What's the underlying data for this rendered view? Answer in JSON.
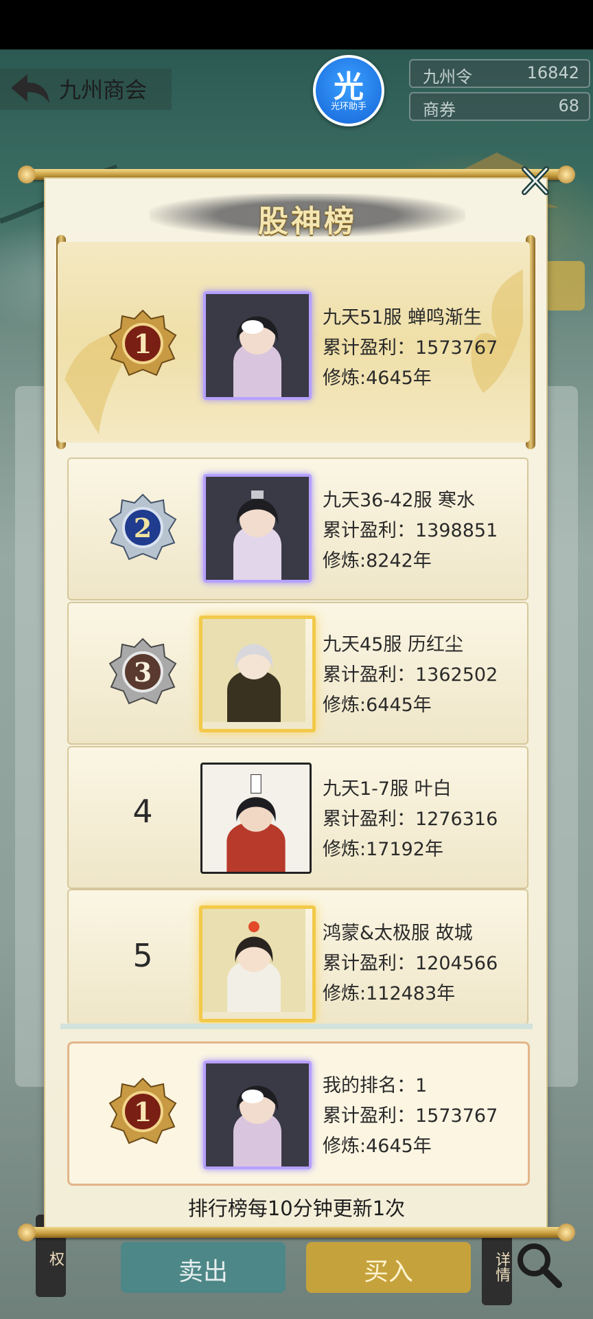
{
  "header": {
    "title": "九州商会",
    "helper_glyph": "光",
    "helper_label": "光环助手",
    "currencies": [
      {
        "name": "九州令",
        "value": "16842"
      },
      {
        "name": "商券",
        "value": "68"
      }
    ]
  },
  "modal": {
    "title": "股神榜",
    "rankings": [
      {
        "rank": "1",
        "badge": "gold-medal",
        "server_name": "九天51服 蝉鸣渐生",
        "profit": "累计盈利：1573767",
        "cultivation": "修炼:4645年"
      },
      {
        "rank": "2",
        "badge": "blue-medal",
        "server_name": "九天36-42服 寒水",
        "profit": "累计盈利：1398851",
        "cultivation": "修炼:8242年"
      },
      {
        "rank": "3",
        "badge": "silver-medal",
        "server_name": "九天45服 历红尘",
        "profit": "累计盈利：1362502",
        "cultivation": "修炼:6445年"
      },
      {
        "rank": "4",
        "badge": "none",
        "server_name": "九天1-7服 叶白",
        "profit": "累计盈利：1276316",
        "cultivation": "修炼:17192年"
      },
      {
        "rank": "5",
        "badge": "none",
        "server_name": "鸿蒙&太极服 故城",
        "profit": "累计盈利：1204566",
        "cultivation": "修炼:112483年"
      }
    ],
    "my_rank": {
      "rank": "1",
      "label": "我的排名：1",
      "profit": "累计盈利：1573767",
      "cultivation": "修炼:4645年"
    },
    "footer_note": "排行榜每10分钟更新1次"
  },
  "bottom_bar": {
    "sell_label": "卖出",
    "buy_label": "买入"
  },
  "colors": {
    "gold": "#c6a23c",
    "teal_button": "#4d8787",
    "paper": "#f7f3e2"
  }
}
